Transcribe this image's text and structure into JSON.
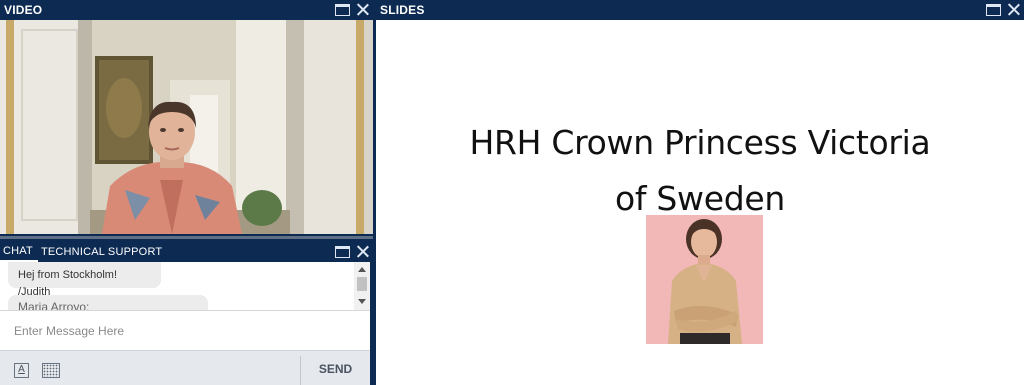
{
  "video": {
    "title": "VIDEO"
  },
  "slides": {
    "title": "SLIDES",
    "heading_line1": "HRH Crown Princess Victoria",
    "heading_line2": "of Sweden"
  },
  "chat": {
    "tabs": [
      {
        "label": "CHAT"
      },
      {
        "label": "TECHNICAL SUPPORT"
      }
    ],
    "messages": [
      {
        "text": "Hej from Stockholm! /Judith"
      },
      {
        "text": "Maria Arroyo:"
      }
    ],
    "input_placeholder": "Enter Message Here",
    "send_label": "SEND"
  },
  "icons": [
    "maximize-icon",
    "close-icon",
    "font-format-icon",
    "calendar-icon",
    "scroll-up-icon",
    "scroll-down-icon"
  ],
  "colors": {
    "header_bg": "#0d2a52",
    "toolbar_bg": "#e5e9ee",
    "photo_bg": "#f2b8b8"
  }
}
